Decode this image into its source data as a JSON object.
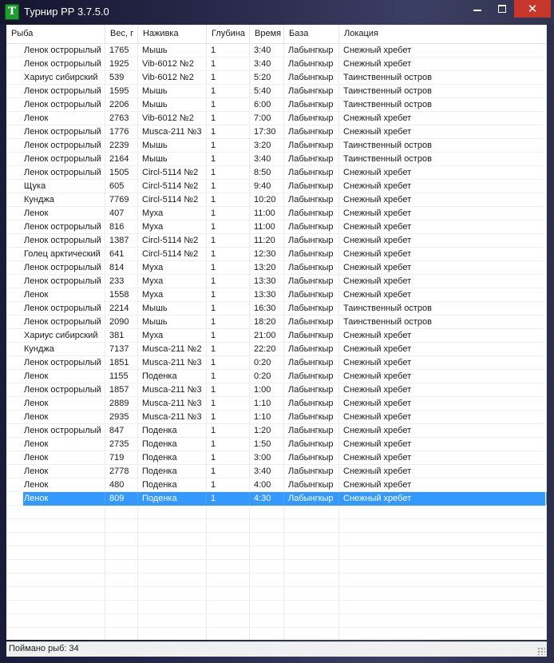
{
  "window": {
    "title": "Турнир РР 3.7.5.0",
    "icon_letter": "T",
    "minimize_icon": "minimize-icon",
    "maximize_icon": "maximize-icon",
    "close_icon": "close-icon",
    "close_glyph": "✕"
  },
  "table": {
    "columns": [
      "Рыба",
      "Вес, г",
      "Наживка",
      "Глубина",
      "Время",
      "База",
      "Локация"
    ],
    "rows": [
      [
        "Ленок острорылый",
        "1765",
        "Мышь",
        "1",
        "3:40",
        "Лабынгкыр",
        "Снежный хребет"
      ],
      [
        "Ленок острорылый",
        "1925",
        "Vib-6012 №2",
        "1",
        "3:40",
        "Лабынгкыр",
        "Снежный хребет"
      ],
      [
        "Хариус сибирский",
        "539",
        "Vib-6012 №2",
        "1",
        "5:20",
        "Лабынгкыр",
        "Таинственный остров"
      ],
      [
        "Ленок острорылый",
        "1595",
        "Мышь",
        "1",
        "5:40",
        "Лабынгкыр",
        "Таинственный остров"
      ],
      [
        "Ленок острорылый",
        "2206",
        "Мышь",
        "1",
        "6:00",
        "Лабынгкыр",
        "Таинственный остров"
      ],
      [
        "Ленок",
        "2763",
        "Vib-6012 №2",
        "1",
        "7:00",
        "Лабынгкыр",
        "Снежный хребет"
      ],
      [
        "Ленок острорылый",
        "1776",
        "Musca-211 №3",
        "1",
        "17:30",
        "Лабынгкыр",
        "Снежный хребет"
      ],
      [
        "Ленок острорылый",
        "2239",
        "Мышь",
        "1",
        "3:20",
        "Лабынгкыр",
        "Таинственный остров"
      ],
      [
        "Ленок острорылый",
        "2164",
        "Мышь",
        "1",
        "3:40",
        "Лабынгкыр",
        "Таинственный остров"
      ],
      [
        "Ленок острорылый",
        "1505",
        "Circl-5114 №2",
        "1",
        "8:50",
        "Лабынгкыр",
        "Снежный хребет"
      ],
      [
        "Щука",
        "605",
        "Circl-5114 №2",
        "1",
        "9:40",
        "Лабынгкыр",
        "Снежный хребет"
      ],
      [
        "Кунджа",
        "7769",
        "Circl-5114 №2",
        "1",
        "10:20",
        "Лабынгкыр",
        "Снежный хребет"
      ],
      [
        "Ленок",
        "407",
        "Муха",
        "1",
        "11:00",
        "Лабынгкыр",
        "Снежный хребет"
      ],
      [
        "Ленок острорылый",
        "816",
        "Муха",
        "1",
        "11:00",
        "Лабынгкыр",
        "Снежный хребет"
      ],
      [
        "Ленок острорылый",
        "1387",
        "Circl-5114 №2",
        "1",
        "11:20",
        "Лабынгкыр",
        "Снежный хребет"
      ],
      [
        "Голец арктический",
        "641",
        "Circl-5114 №2",
        "1",
        "12:30",
        "Лабынгкыр",
        "Снежный хребет"
      ],
      [
        "Ленок острорылый",
        "814",
        "Муха",
        "1",
        "13:20",
        "Лабынгкыр",
        "Снежный хребет"
      ],
      [
        "Ленок острорылый",
        "233",
        "Муха",
        "1",
        "13:30",
        "Лабынгкыр",
        "Снежный хребет"
      ],
      [
        "Ленок",
        "1558",
        "Муха",
        "1",
        "13:30",
        "Лабынгкыр",
        "Снежный хребет"
      ],
      [
        "Ленок острорылый",
        "2214",
        "Мышь",
        "1",
        "16:30",
        "Лабынгкыр",
        "Таинственный остров"
      ],
      [
        "Ленок острорылый",
        "2090",
        "Мышь",
        "1",
        "18:20",
        "Лабынгкыр",
        "Таинственный остров"
      ],
      [
        "Хариус сибирский",
        "381",
        "Муха",
        "1",
        "21:00",
        "Лабынгкыр",
        "Снежный хребет"
      ],
      [
        "Кунджа",
        "7137",
        "Musca-211 №2",
        "1",
        "22:20",
        "Лабынгкыр",
        "Снежный хребет"
      ],
      [
        "Ленок острорылый",
        "1851",
        "Musca-211 №3",
        "1",
        "0:20",
        "Лабынгкыр",
        "Снежный хребет"
      ],
      [
        "Ленок",
        "1155",
        "Поденка",
        "1",
        "0:20",
        "Лабынгкыр",
        "Снежный хребет"
      ],
      [
        "Ленок острорылый",
        "1857",
        "Musca-211 №3",
        "1",
        "1:00",
        "Лабынгкыр",
        "Снежный хребет"
      ],
      [
        "Ленок",
        "2889",
        "Musca-211 №3",
        "1",
        "1:10",
        "Лабынгкыр",
        "Снежный хребет"
      ],
      [
        "Ленок",
        "2935",
        "Musca-211 №3",
        "1",
        "1:10",
        "Лабынгкыр",
        "Снежный хребет"
      ],
      [
        "Ленок острорылый",
        "847",
        "Поденка",
        "1",
        "1:20",
        "Лабынгкыр",
        "Снежный хребет"
      ],
      [
        "Ленок",
        "2735",
        "Поденка",
        "1",
        "1:50",
        "Лабынгкыр",
        "Снежный хребет"
      ],
      [
        "Ленок",
        "719",
        "Поденка",
        "1",
        "3:00",
        "Лабынгкыр",
        "Снежный хребет"
      ],
      [
        "Ленок",
        "2778",
        "Поденка",
        "1",
        "3:40",
        "Лабынгкыр",
        "Снежный хребет"
      ],
      [
        "Ленок",
        "480",
        "Поденка",
        "1",
        "4:00",
        "Лабынгкыр",
        "Снежный хребет"
      ],
      [
        "Ленок",
        "809",
        "Поденка",
        "1",
        "4:30",
        "Лабынгкыр",
        "Снежный хребет"
      ]
    ],
    "selected_row_index": 33,
    "selection_color": "#3399ff"
  },
  "status": {
    "caught_text": "Поймано рыб: 34"
  }
}
